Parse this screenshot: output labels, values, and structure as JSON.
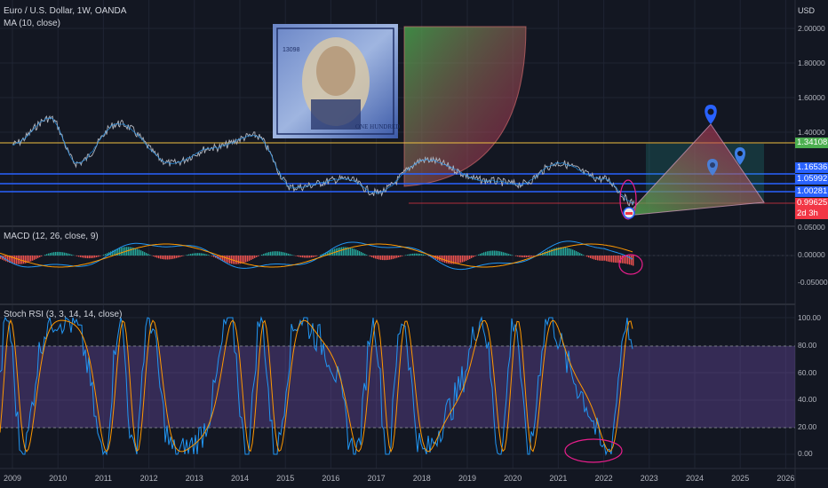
{
  "header": {
    "symbol_line": "Euro / U.S. Dollar, 1W, OANDA",
    "ma_line": "MA (10, close)",
    "currency": "USD"
  },
  "macd_label": "MACD (12, 26, close, 9)",
  "stoch_label": "Stoch RSI (3, 3, 14, 14, close)",
  "price_axis": {
    "ticks": [
      "2.00000",
      "1.80000",
      "1.60000",
      "1.40000",
      "0.05000"
    ],
    "badges": [
      {
        "text": "1.34108",
        "color": "#4caf50"
      },
      {
        "text": "1.16536",
        "color": "#2962ff"
      },
      {
        "text": "1.05992",
        "color": "#2962ff"
      },
      {
        "text": "1.00281",
        "color": "#2962ff"
      },
      {
        "text": "0.99625",
        "color": "#f23645"
      },
      {
        "text": "2d 3h",
        "color": "#f23645"
      }
    ]
  },
  "macd_axis": {
    "ticks": [
      "0.00000",
      "-0.05000"
    ]
  },
  "stoch_axis": {
    "ticks": [
      "100.00",
      "80.00",
      "60.00",
      "40.00",
      "20.00",
      "0.00"
    ]
  },
  "time_axis": {
    "years": [
      "2009",
      "2010",
      "2011",
      "2012",
      "2013",
      "2014",
      "2015",
      "2016",
      "2017",
      "2018",
      "2019",
      "2020",
      "2021",
      "2022",
      "2023",
      "2024",
      "2025",
      "2026"
    ]
  },
  "drawings": {
    "image": "hundred-dollar-bill-picture",
    "pins": [
      "map-pin-icon",
      "map-pin-icon",
      "map-pin-icon"
    ]
  },
  "chart_data": {
    "type": "line",
    "title": "Euro / U.S. Dollar, 1W, OANDA",
    "x_range": [
      "2009",
      "2026"
    ],
    "series": [
      {
        "name": "MA (10, close)",
        "approx_points": [
          [
            "2009-01",
            1.33
          ],
          [
            "2009-11",
            1.48
          ],
          [
            "2010-06",
            1.22
          ],
          [
            "2011-05",
            1.45
          ],
          [
            "2012-07",
            1.22
          ],
          [
            "2013-06",
            1.31
          ],
          [
            "2014-05",
            1.38
          ],
          [
            "2015-03",
            1.08
          ],
          [
            "2016-05",
            1.13
          ],
          [
            "2017-01",
            1.05
          ],
          [
            "2018-02",
            1.24
          ],
          [
            "2019-06",
            1.12
          ],
          [
            "2020-03",
            1.1
          ],
          [
            "2021-01",
            1.22
          ],
          [
            "2022-01",
            1.13
          ],
          [
            "2022-09",
            0.99
          ]
        ]
      }
    ],
    "horizontal_levels": [
      {
        "value": 1.34108,
        "color": "#f0c040"
      },
      {
        "value": 1.16536,
        "color": "#2962ff"
      },
      {
        "value": 1.05992,
        "color": "#2962ff"
      },
      {
        "value": 1.00281,
        "color": "#2962ff"
      },
      {
        "value": 0.99625,
        "color": "#f23645"
      }
    ],
    "stoch_bands": [
      20,
      80
    ],
    "grid": true
  }
}
